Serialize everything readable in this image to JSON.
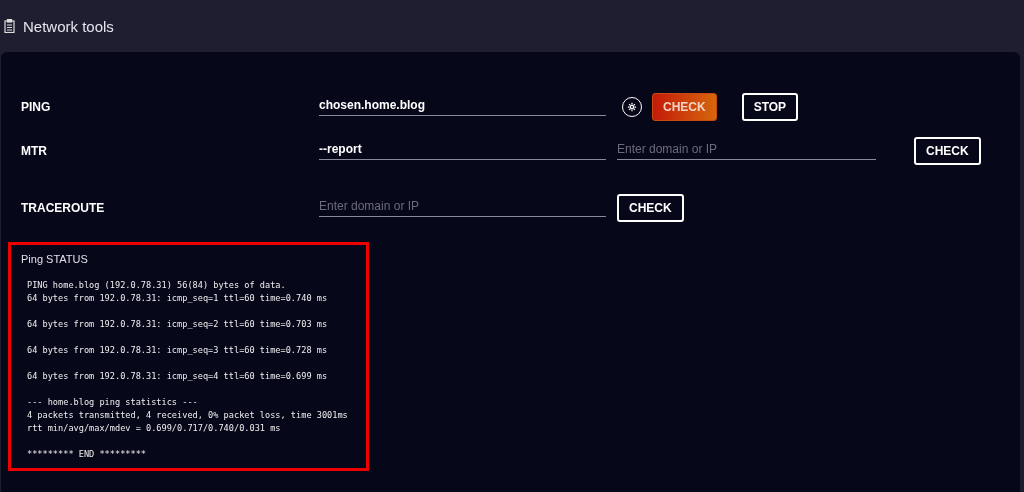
{
  "header": {
    "title": "Network tools"
  },
  "tools": [
    {
      "label": "PING",
      "fields": [
        {
          "value": "chosen.home.blog"
        }
      ],
      "buttons": [
        {
          "kind": "gear"
        },
        {
          "kind": "primary",
          "label": "CHECK"
        },
        {
          "kind": "outline",
          "label": "STOP"
        }
      ]
    },
    {
      "label": "MTR",
      "fields": [
        {
          "value": "--report"
        },
        {
          "placeholder": "Enter domain or IP"
        }
      ],
      "buttons": [
        {
          "kind": "outline",
          "label": "CHECK"
        }
      ]
    },
    {
      "label": "TRACEROUTE",
      "fields": [
        {
          "placeholder": "Enter domain or IP"
        }
      ],
      "buttons": [
        {
          "kind": "outline",
          "label": "CHECK"
        }
      ]
    }
  ],
  "status": {
    "title": "Ping STATUS",
    "blocks": [
      [
        "PING home.blog (192.0.78.31) 56(84) bytes of data.",
        "64 bytes from 192.0.78.31: icmp_seq=1 ttl=60 time=0.740 ms"
      ],
      [
        "64 bytes from 192.0.78.31: icmp_seq=2 ttl=60 time=0.703 ms"
      ],
      [
        "64 bytes from 192.0.78.31: icmp_seq=3 ttl=60 time=0.728 ms"
      ],
      [
        "64 bytes from 192.0.78.31: icmp_seq=4 ttl=60 time=0.699 ms"
      ],
      [
        "--- home.blog ping statistics ---",
        "4 packets transmitted, 4 received, 0% packet loss, time 3001ms",
        "rtt min/avg/max/mdev = 0.699/0.717/0.740/0.031 ms"
      ],
      [
        "********* END *********"
      ]
    ]
  }
}
